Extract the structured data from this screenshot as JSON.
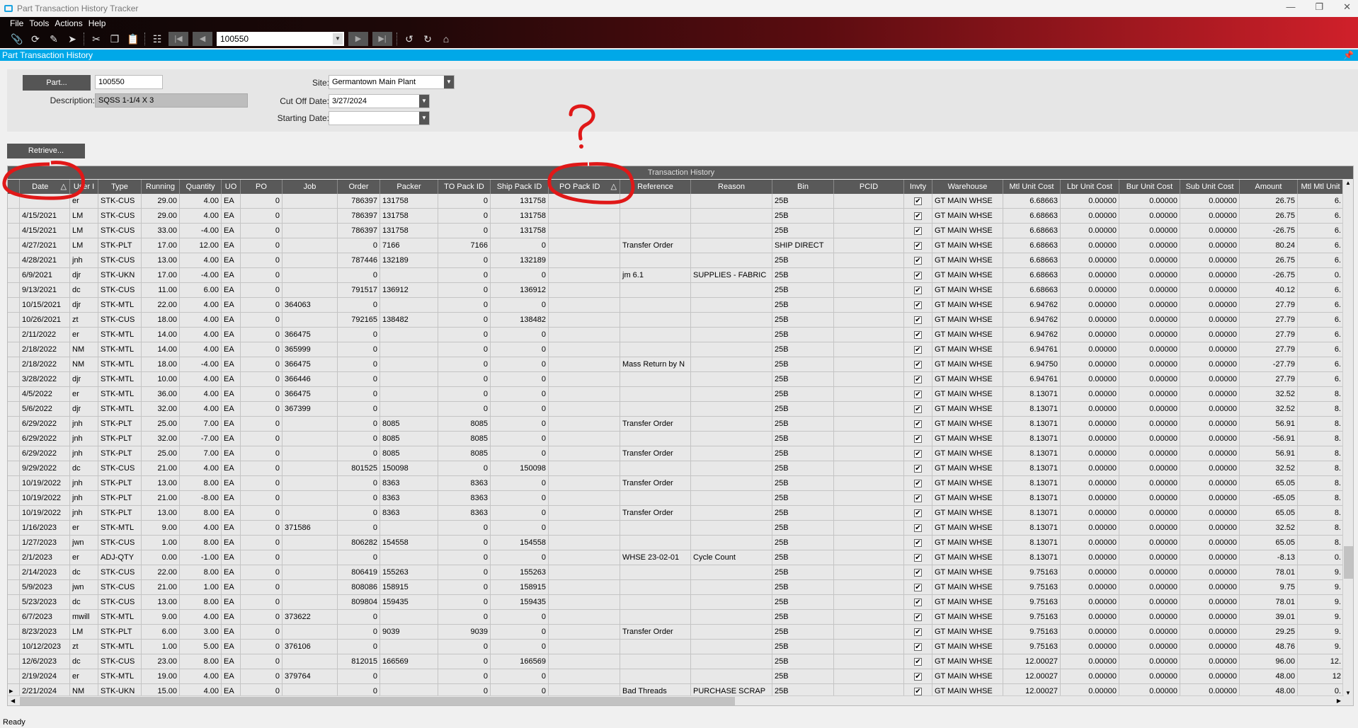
{
  "window": {
    "title": "Part Transaction History Tracker"
  },
  "menu": [
    "File",
    "Tools",
    "Actions",
    "Help"
  ],
  "toolbar": {
    "record_value": "100550",
    "icons": [
      "attach-icon",
      "refresh-icon",
      "clear-icon",
      "go-icon",
      "cut-icon",
      "copy-icon",
      "paste-icon",
      "search-binoculars-icon",
      "first-icon",
      "previous-icon",
      "next-icon",
      "last-icon",
      "back-icon",
      "forward-icon",
      "home-icon"
    ]
  },
  "panel": {
    "title": "Part Transaction History"
  },
  "form": {
    "part_button": "Part...",
    "part_value": "100550",
    "description_label": "Description:",
    "description_value": "SQSS 1-1/4 X 3",
    "site_label": "Site:",
    "site_value": "Germantown Main Plant",
    "cutoff_label": "Cut Off Date:",
    "cutoff_value": "3/27/2024",
    "starting_label": "Starting Date:",
    "starting_value": "",
    "retrieve_button": "Retrieve..."
  },
  "grid": {
    "group_title": "Transaction History",
    "sorted_columns": [
      "Date",
      "PO Pack ID"
    ],
    "columns": [
      "Date",
      "User I",
      "Type",
      "Running",
      "Quantity",
      "UO",
      "PO",
      "Job",
      "Order",
      "Packer",
      "TO Pack ID",
      "Ship Pack ID",
      "PO Pack ID",
      "Reference",
      "Reason",
      "Bin",
      "PCID",
      "Invty",
      "Warehouse",
      "Mtl Unit Cost",
      "Lbr Unit Cost",
      "Bur Unit Cost",
      "Sub Unit Cost",
      "Amount",
      "Mtl Mtl Unit"
    ],
    "rows": [
      [
        "",
        "er",
        "STK-CUS",
        "29.00",
        "4.00",
        "EA",
        "0",
        "",
        "786397",
        "131758",
        "0",
        "131758",
        "",
        "",
        "",
        "25B",
        "",
        true,
        "GT MAIN WHSE",
        "6.68663",
        "0.00000",
        "0.00000",
        "0.00000",
        "26.75",
        "6."
      ],
      [
        "4/15/2021",
        "LM",
        "STK-CUS",
        "29.00",
        "4.00",
        "EA",
        "0",
        "",
        "786397",
        "131758",
        "0",
        "131758",
        "",
        "",
        "",
        "25B",
        "",
        true,
        "GT MAIN WHSE",
        "6.68663",
        "0.00000",
        "0.00000",
        "0.00000",
        "26.75",
        "6."
      ],
      [
        "4/15/2021",
        "LM",
        "STK-CUS",
        "33.00",
        "-4.00",
        "EA",
        "0",
        "",
        "786397",
        "131758",
        "0",
        "131758",
        "",
        "",
        "",
        "25B",
        "",
        true,
        "GT MAIN WHSE",
        "6.68663",
        "0.00000",
        "0.00000",
        "0.00000",
        "-26.75",
        "6."
      ],
      [
        "4/27/2021",
        "LM",
        "STK-PLT",
        "17.00",
        "12.00",
        "EA",
        "0",
        "",
        "0",
        "7166",
        "7166",
        "0",
        "",
        "Transfer Order",
        "",
        "SHIP DIRECT",
        "",
        true,
        "GT MAIN WHSE",
        "6.68663",
        "0.00000",
        "0.00000",
        "0.00000",
        "80.24",
        "6."
      ],
      [
        "4/28/2021",
        "jnh",
        "STK-CUS",
        "13.00",
        "4.00",
        "EA",
        "0",
        "",
        "787446",
        "132189",
        "0",
        "132189",
        "",
        "",
        "",
        "25B",
        "",
        true,
        "GT MAIN WHSE",
        "6.68663",
        "0.00000",
        "0.00000",
        "0.00000",
        "26.75",
        "6."
      ],
      [
        "6/9/2021",
        "djr",
        "STK-UKN",
        "17.00",
        "-4.00",
        "EA",
        "0",
        "",
        "0",
        "",
        "0",
        "0",
        "",
        "jm 6.1",
        "SUPPLIES - FABRIC",
        "25B",
        "",
        true,
        "GT MAIN WHSE",
        "6.68663",
        "0.00000",
        "0.00000",
        "0.00000",
        "-26.75",
        "0."
      ],
      [
        "9/13/2021",
        "dc",
        "STK-CUS",
        "11.00",
        "6.00",
        "EA",
        "0",
        "",
        "791517",
        "136912",
        "0",
        "136912",
        "",
        "",
        "",
        "25B",
        "",
        true,
        "GT MAIN WHSE",
        "6.68663",
        "0.00000",
        "0.00000",
        "0.00000",
        "40.12",
        "6."
      ],
      [
        "10/15/2021",
        "djr",
        "STK-MTL",
        "22.00",
        "4.00",
        "EA",
        "0",
        "364063",
        "0",
        "",
        "0",
        "0",
        "",
        "",
        "",
        "25B",
        "",
        true,
        "GT MAIN WHSE",
        "6.94762",
        "0.00000",
        "0.00000",
        "0.00000",
        "27.79",
        "6."
      ],
      [
        "10/26/2021",
        "zt",
        "STK-CUS",
        "18.00",
        "4.00",
        "EA",
        "0",
        "",
        "792165",
        "138482",
        "0",
        "138482",
        "",
        "",
        "",
        "25B",
        "",
        true,
        "GT MAIN WHSE",
        "6.94762",
        "0.00000",
        "0.00000",
        "0.00000",
        "27.79",
        "6."
      ],
      [
        "2/11/2022",
        "er",
        "STK-MTL",
        "14.00",
        "4.00",
        "EA",
        "0",
        "366475",
        "0",
        "",
        "0",
        "0",
        "",
        "",
        "",
        "25B",
        "",
        true,
        "GT MAIN WHSE",
        "6.94762",
        "0.00000",
        "0.00000",
        "0.00000",
        "27.79",
        "6."
      ],
      [
        "2/18/2022",
        "NM",
        "STK-MTL",
        "14.00",
        "4.00",
        "EA",
        "0",
        "365999",
        "0",
        "",
        "0",
        "0",
        "",
        "",
        "",
        "25B",
        "",
        true,
        "GT MAIN WHSE",
        "6.94761",
        "0.00000",
        "0.00000",
        "0.00000",
        "27.79",
        "6."
      ],
      [
        "2/18/2022",
        "NM",
        "STK-MTL",
        "18.00",
        "-4.00",
        "EA",
        "0",
        "366475",
        "0",
        "",
        "0",
        "0",
        "",
        "Mass Return by N",
        "",
        "25B",
        "",
        true,
        "GT MAIN WHSE",
        "6.94750",
        "0.00000",
        "0.00000",
        "0.00000",
        "-27.79",
        "6."
      ],
      [
        "3/28/2022",
        "djr",
        "STK-MTL",
        "10.00",
        "4.00",
        "EA",
        "0",
        "366446",
        "0",
        "",
        "0",
        "0",
        "",
        "",
        "",
        "25B",
        "",
        true,
        "GT MAIN WHSE",
        "6.94761",
        "0.00000",
        "0.00000",
        "0.00000",
        "27.79",
        "6."
      ],
      [
        "4/5/2022",
        "er",
        "STK-MTL",
        "36.00",
        "4.00",
        "EA",
        "0",
        "366475",
        "0",
        "",
        "0",
        "0",
        "",
        "",
        "",
        "25B",
        "",
        true,
        "GT MAIN WHSE",
        "8.13071",
        "0.00000",
        "0.00000",
        "0.00000",
        "32.52",
        "8."
      ],
      [
        "5/6/2022",
        "djr",
        "STK-MTL",
        "32.00",
        "4.00",
        "EA",
        "0",
        "367399",
        "0",
        "",
        "0",
        "0",
        "",
        "",
        "",
        "25B",
        "",
        true,
        "GT MAIN WHSE",
        "8.13071",
        "0.00000",
        "0.00000",
        "0.00000",
        "32.52",
        "8."
      ],
      [
        "6/29/2022",
        "jnh",
        "STK-PLT",
        "25.00",
        "7.00",
        "EA",
        "0",
        "",
        "0",
        "8085",
        "8085",
        "0",
        "",
        "Transfer Order",
        "",
        "25B",
        "",
        true,
        "GT MAIN WHSE",
        "8.13071",
        "0.00000",
        "0.00000",
        "0.00000",
        "56.91",
        "8."
      ],
      [
        "6/29/2022",
        "jnh",
        "STK-PLT",
        "32.00",
        "-7.00",
        "EA",
        "0",
        "",
        "0",
        "8085",
        "8085",
        "0",
        "",
        "",
        "",
        "25B",
        "",
        true,
        "GT MAIN WHSE",
        "8.13071",
        "0.00000",
        "0.00000",
        "0.00000",
        "-56.91",
        "8."
      ],
      [
        "6/29/2022",
        "jnh",
        "STK-PLT",
        "25.00",
        "7.00",
        "EA",
        "0",
        "",
        "0",
        "8085",
        "8085",
        "0",
        "",
        "Transfer Order",
        "",
        "25B",
        "",
        true,
        "GT MAIN WHSE",
        "8.13071",
        "0.00000",
        "0.00000",
        "0.00000",
        "56.91",
        "8."
      ],
      [
        "9/29/2022",
        "dc",
        "STK-CUS",
        "21.00",
        "4.00",
        "EA",
        "0",
        "",
        "801525",
        "150098",
        "0",
        "150098",
        "",
        "",
        "",
        "25B",
        "",
        true,
        "GT MAIN WHSE",
        "8.13071",
        "0.00000",
        "0.00000",
        "0.00000",
        "32.52",
        "8."
      ],
      [
        "10/19/2022",
        "jnh",
        "STK-PLT",
        "13.00",
        "8.00",
        "EA",
        "0",
        "",
        "0",
        "8363",
        "8363",
        "0",
        "",
        "Transfer Order",
        "",
        "25B",
        "",
        true,
        "GT MAIN WHSE",
        "8.13071",
        "0.00000",
        "0.00000",
        "0.00000",
        "65.05",
        "8."
      ],
      [
        "10/19/2022",
        "jnh",
        "STK-PLT",
        "21.00",
        "-8.00",
        "EA",
        "0",
        "",
        "0",
        "8363",
        "8363",
        "0",
        "",
        "",
        "",
        "25B",
        "",
        true,
        "GT MAIN WHSE",
        "8.13071",
        "0.00000",
        "0.00000",
        "0.00000",
        "-65.05",
        "8."
      ],
      [
        "10/19/2022",
        "jnh",
        "STK-PLT",
        "13.00",
        "8.00",
        "EA",
        "0",
        "",
        "0",
        "8363",
        "8363",
        "0",
        "",
        "Transfer Order",
        "",
        "25B",
        "",
        true,
        "GT MAIN WHSE",
        "8.13071",
        "0.00000",
        "0.00000",
        "0.00000",
        "65.05",
        "8."
      ],
      [
        "1/16/2023",
        "er",
        "STK-MTL",
        "9.00",
        "4.00",
        "EA",
        "0",
        "371586",
        "0",
        "",
        "0",
        "0",
        "",
        "",
        "",
        "25B",
        "",
        true,
        "GT MAIN WHSE",
        "8.13071",
        "0.00000",
        "0.00000",
        "0.00000",
        "32.52",
        "8."
      ],
      [
        "1/27/2023",
        "jwn",
        "STK-CUS",
        "1.00",
        "8.00",
        "EA",
        "0",
        "",
        "806282",
        "154558",
        "0",
        "154558",
        "",
        "",
        "",
        "25B",
        "",
        true,
        "GT MAIN WHSE",
        "8.13071",
        "0.00000",
        "0.00000",
        "0.00000",
        "65.05",
        "8."
      ],
      [
        "2/1/2023",
        "er",
        "ADJ-QTY",
        "0.00",
        "-1.00",
        "EA",
        "0",
        "",
        "0",
        "",
        "0",
        "0",
        "",
        "WHSE 23-02-01",
        "Cycle Count",
        "25B",
        "",
        true,
        "GT MAIN WHSE",
        "8.13071",
        "0.00000",
        "0.00000",
        "0.00000",
        "-8.13",
        "0."
      ],
      [
        "2/14/2023",
        "dc",
        "STK-CUS",
        "22.00",
        "8.00",
        "EA",
        "0",
        "",
        "806419",
        "155263",
        "0",
        "155263",
        "",
        "",
        "",
        "25B",
        "",
        true,
        "GT MAIN WHSE",
        "9.75163",
        "0.00000",
        "0.00000",
        "0.00000",
        "78.01",
        "9."
      ],
      [
        "5/9/2023",
        "jwn",
        "STK-CUS",
        "21.00",
        "1.00",
        "EA",
        "0",
        "",
        "808086",
        "158915",
        "0",
        "158915",
        "",
        "",
        "",
        "25B",
        "",
        true,
        "GT MAIN WHSE",
        "9.75163",
        "0.00000",
        "0.00000",
        "0.00000",
        "9.75",
        "9."
      ],
      [
        "5/23/2023",
        "dc",
        "STK-CUS",
        "13.00",
        "8.00",
        "EA",
        "0",
        "",
        "809804",
        "159435",
        "0",
        "159435",
        "",
        "",
        "",
        "25B",
        "",
        true,
        "GT MAIN WHSE",
        "9.75163",
        "0.00000",
        "0.00000",
        "0.00000",
        "78.01",
        "9."
      ],
      [
        "6/7/2023",
        "mwill",
        "STK-MTL",
        "9.00",
        "4.00",
        "EA",
        "0",
        "373622",
        "0",
        "",
        "0",
        "0",
        "",
        "",
        "",
        "25B",
        "",
        true,
        "GT MAIN WHSE",
        "9.75163",
        "0.00000",
        "0.00000",
        "0.00000",
        "39.01",
        "9."
      ],
      [
        "8/23/2023",
        "LM",
        "STK-PLT",
        "6.00",
        "3.00",
        "EA",
        "0",
        "",
        "0",
        "9039",
        "9039",
        "0",
        "",
        "Transfer Order",
        "",
        "25B",
        "",
        true,
        "GT MAIN WHSE",
        "9.75163",
        "0.00000",
        "0.00000",
        "0.00000",
        "29.25",
        "9."
      ],
      [
        "10/12/2023",
        "zt",
        "STK-MTL",
        "1.00",
        "5.00",
        "EA",
        "0",
        "376106",
        "0",
        "",
        "0",
        "0",
        "",
        "",
        "",
        "25B",
        "",
        true,
        "GT MAIN WHSE",
        "9.75163",
        "0.00000",
        "0.00000",
        "0.00000",
        "48.76",
        "9."
      ],
      [
        "12/6/2023",
        "dc",
        "STK-CUS",
        "23.00",
        "8.00",
        "EA",
        "0",
        "",
        "812015",
        "166569",
        "0",
        "166569",
        "",
        "",
        "",
        "25B",
        "",
        true,
        "GT MAIN WHSE",
        "12.00027",
        "0.00000",
        "0.00000",
        "0.00000",
        "96.00",
        "12."
      ],
      [
        "2/19/2024",
        "er",
        "STK-MTL",
        "19.00",
        "4.00",
        "EA",
        "0",
        "379764",
        "0",
        "",
        "0",
        "0",
        "",
        "",
        "",
        "25B",
        "",
        true,
        "GT MAIN WHSE",
        "12.00027",
        "0.00000",
        "0.00000",
        "0.00000",
        "48.00",
        "12"
      ],
      [
        "2/21/2024",
        "NM",
        "STK-UKN",
        "15.00",
        "4.00",
        "EA",
        "0",
        "",
        "0",
        "",
        "0",
        "0",
        "",
        "Bad Threads",
        "PURCHASE SCRAP",
        "25B",
        "",
        true,
        "GT MAIN WHSE",
        "12.00027",
        "0.00000",
        "0.00000",
        "0.00000",
        "48.00",
        "0."
      ]
    ]
  },
  "annotation": {
    "color": "#e01818",
    "mark": "?"
  },
  "status": {
    "text": "Ready"
  },
  "colors": {
    "header_bg": "#595959",
    "accent_blue": "#00a8e8",
    "toolbar_red": "#d0202a"
  }
}
